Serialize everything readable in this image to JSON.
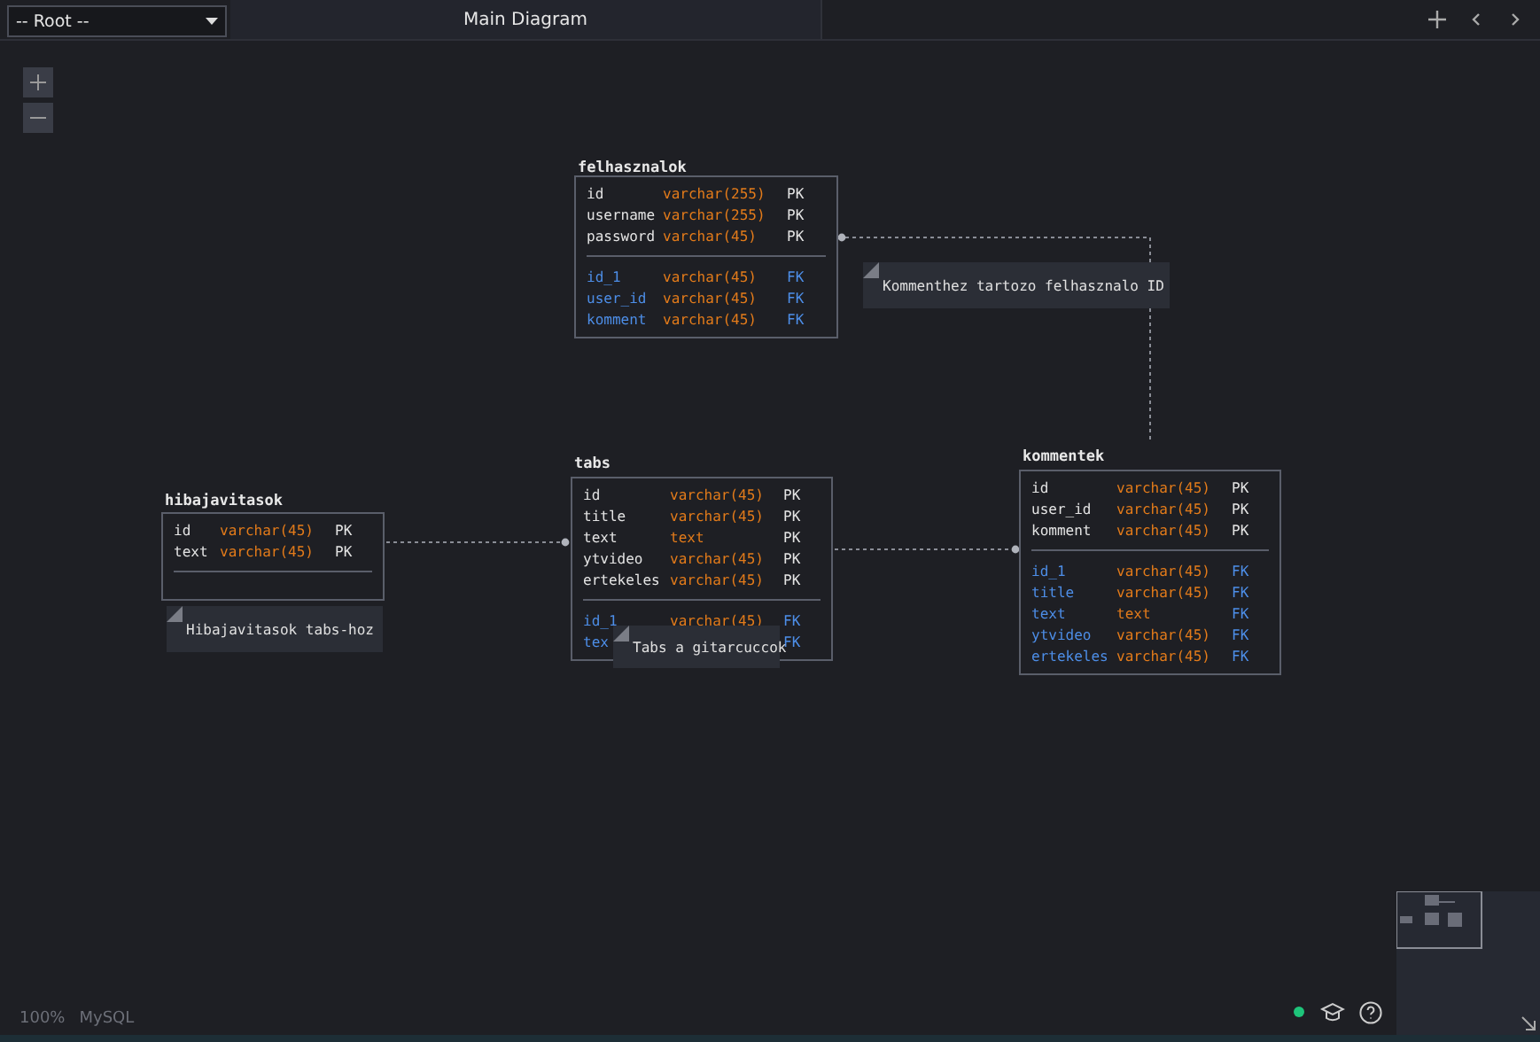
{
  "toolbar": {
    "schema_select": "-- Root --",
    "diagram_tab": {
      "label": "Main Diagram",
      "selected": true
    }
  },
  "tables": [
    {
      "name": "felhasznalok",
      "primary": [
        {
          "name": "id",
          "type": "varchar(255)",
          "key": "PK"
        },
        {
          "name": "username",
          "type": "varchar(255)",
          "key": "PK"
        },
        {
          "name": "password",
          "type": "varchar(45)",
          "key": "PK"
        }
      ],
      "foreign": [
        {
          "name": "id_1",
          "type": "varchar(45)",
          "key": "FK"
        },
        {
          "name": "user_id",
          "type": "varchar(45)",
          "key": "FK"
        },
        {
          "name": "komment",
          "type": "varchar(45)",
          "key": "FK"
        }
      ]
    },
    {
      "name": "hibajavitasok",
      "primary": [
        {
          "name": "id",
          "type": "varchar(45)",
          "key": "PK"
        },
        {
          "name": "text",
          "type": "varchar(45)",
          "key": "PK"
        }
      ]
    },
    {
      "name": "tabs",
      "primary": [
        {
          "name": "id",
          "type": "varchar(45)",
          "key": "PK"
        },
        {
          "name": "title",
          "type": "varchar(45)",
          "key": "PK"
        },
        {
          "name": "text",
          "type": "text",
          "key": "PK"
        },
        {
          "name": "ytvideo",
          "type": "varchar(45)",
          "key": "PK"
        },
        {
          "name": "ertekeles",
          "type": "varchar(45)",
          "key": "PK"
        }
      ],
      "foreign": [
        {
          "name": "id_1",
          "type": "varchar(45)",
          "key": "FK"
        },
        {
          "name": "tex",
          "key": "FK"
        }
      ]
    },
    {
      "name": "kommentek",
      "primary": [
        {
          "name": "id",
          "type": "varchar(45)",
          "key": "PK"
        },
        {
          "name": "user_id",
          "type": "varchar(45)",
          "key": "PK"
        },
        {
          "name": "komment",
          "type": "varchar(45)",
          "key": "PK"
        }
      ],
      "foreign": [
        {
          "name": "id_1",
          "type": "varchar(45)",
          "key": "FK"
        },
        {
          "name": "title",
          "type": "varchar(45)",
          "key": "FK"
        },
        {
          "name": "text",
          "type": "text",
          "key": "FK"
        },
        {
          "name": "ytvideo",
          "type": "varchar(45)",
          "key": "FK"
        },
        {
          "name": "ertekeles",
          "type": "varchar(45)",
          "key": "FK"
        }
      ]
    }
  ],
  "notes": [
    {
      "text": "Kommenthez tartozo felhasznalo ID"
    },
    {
      "text": "Hibajavitasok tabs-hoz"
    },
    {
      "text": "Tabs a gitarcuccok"
    }
  ],
  "status_bar": {
    "zoom": "100%",
    "database": "MySQL",
    "connected": true
  }
}
